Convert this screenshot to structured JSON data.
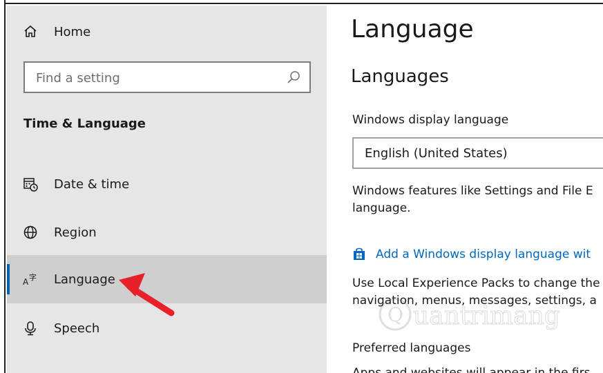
{
  "sidebar": {
    "home_label": "Home",
    "search_placeholder": "Find a setting",
    "section_title": "Time & Language",
    "items": [
      {
        "label": "Date & time",
        "icon": "calendar-clock-icon"
      },
      {
        "label": "Region",
        "icon": "globe-icon"
      },
      {
        "label": "Language",
        "icon": "language-icon",
        "active": true
      },
      {
        "label": "Speech",
        "icon": "microphone-icon"
      }
    ]
  },
  "main": {
    "title": "Language",
    "subheading": "Languages",
    "display_language_label": "Windows display language",
    "display_language_value": "English (United States)",
    "display_language_desc_line1": "Windows features like Settings and File E",
    "display_language_desc_line2": "language.",
    "add_language_link": "Add a Windows display language wit",
    "add_language_icon": "store-icon",
    "lep_desc_line1": "Use Local Experience Packs to change the",
    "lep_desc_line2": "navigation, menus, messages, settings, a",
    "preferred_label": "Preferred languages",
    "preferred_desc_partial": "Apps and websites will appear in the firs"
  },
  "colors": {
    "sidebar_bg": "#e6e6e6",
    "active_item_bg": "#cfcfcf",
    "accent": "#0063b1",
    "link": "#0067c0",
    "annotation_arrow": "#e8202a"
  },
  "watermark_text": "Quantrimang"
}
